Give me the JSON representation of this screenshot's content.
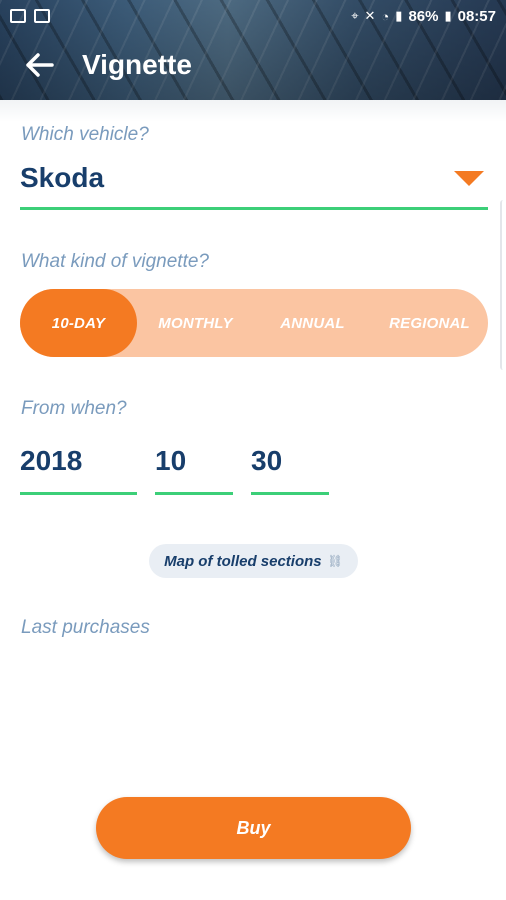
{
  "status_bar": {
    "battery": "86%",
    "time": "08:57"
  },
  "header": {
    "title": "Vignette"
  },
  "vehicle": {
    "label": "Which vehicle?",
    "value": "Skoda"
  },
  "vignette_type": {
    "label": "What kind of vignette?",
    "options": [
      "10-DAY",
      "MONTHLY",
      "ANNUAL",
      "REGIONAL"
    ],
    "selected": "10-DAY"
  },
  "start_date": {
    "label": "From when?",
    "year": "2018",
    "month": "10",
    "day": "30"
  },
  "map_link": {
    "label": "Map of tolled sections"
  },
  "last_purchases": {
    "label": "Last purchases"
  },
  "buy": {
    "label": "Buy"
  },
  "colors": {
    "accent": "#f47a22",
    "accent_light": "#fbc5a2",
    "underline": "#3ccf78",
    "primary_text": "#183e6b",
    "label_text": "#7a9bbd"
  }
}
